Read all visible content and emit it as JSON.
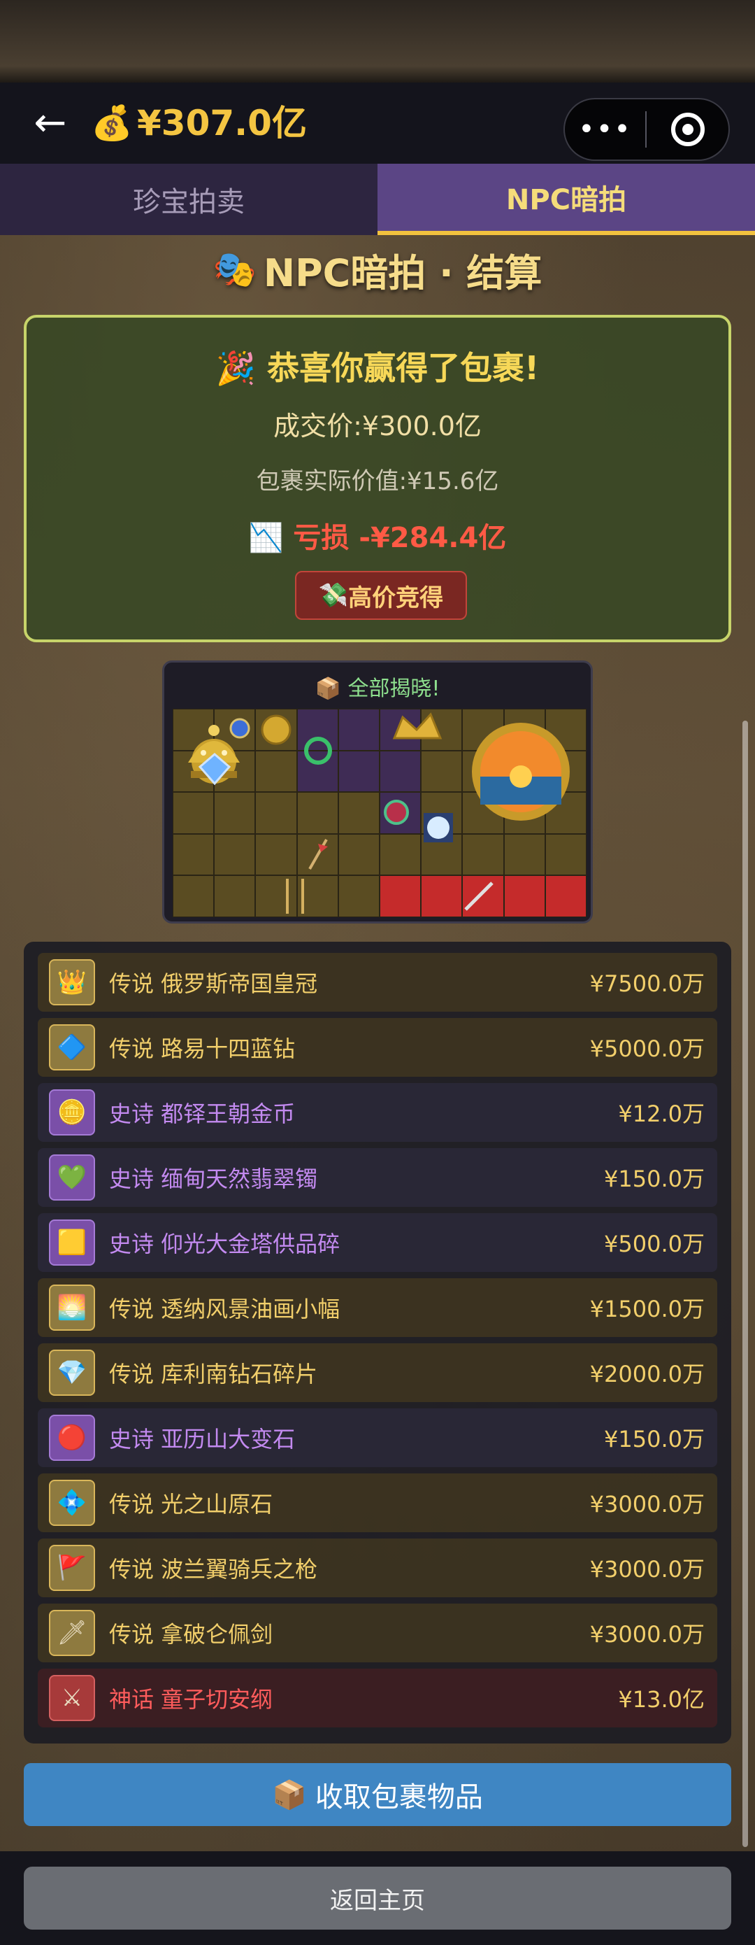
{
  "header": {
    "back_icon": "←",
    "money_icon": "💰",
    "balance": "¥307.0亿",
    "more_label": "•••"
  },
  "tabs": [
    {
      "label": "珍宝拍卖",
      "active": false
    },
    {
      "label": "NPC暗拍",
      "active": true
    }
  ],
  "page_title": "NPC暗拍 · 结算",
  "title_icon": "🎭",
  "result": {
    "congrats_icon": "🎉",
    "congrats": "恭喜你赢得了包裹!",
    "deal_price": "成交价:¥300.0亿",
    "actual_value": "包裹实际价值:¥15.6亿",
    "loss_icon": "📉",
    "loss": "亏损 -¥284.4亿",
    "badge_icon": "💸",
    "badge": "高价竞得"
  },
  "grid": {
    "title_icon": "📦",
    "title": "全部揭晓!"
  },
  "items": [
    {
      "rarity": "legend",
      "name": "传说 俄罗斯帝国皇冠",
      "price": "¥7500.0万",
      "icon": "👑"
    },
    {
      "rarity": "legend",
      "name": "传说 路易十四蓝钻",
      "price": "¥5000.0万",
      "icon": "🔷"
    },
    {
      "rarity": "epic",
      "name": "史诗 都铎王朝金币",
      "price": "¥12.0万",
      "icon": "🪙"
    },
    {
      "rarity": "epic",
      "name": "史诗 缅甸天然翡翠镯",
      "price": "¥150.0万",
      "icon": "💚"
    },
    {
      "rarity": "epic",
      "name": "史诗 仰光大金塔供品碎",
      "price": "¥500.0万",
      "icon": "🟨"
    },
    {
      "rarity": "legend",
      "name": "传说 透纳风景油画小幅",
      "price": "¥1500.0万",
      "icon": "🌅"
    },
    {
      "rarity": "legend",
      "name": "传说 库利南钻石碎片",
      "price": "¥2000.0万",
      "icon": "💎"
    },
    {
      "rarity": "epic",
      "name": "史诗 亚历山大变石",
      "price": "¥150.0万",
      "icon": "🔴"
    },
    {
      "rarity": "legend",
      "name": "传说 光之山原石",
      "price": "¥3000.0万",
      "icon": "💠"
    },
    {
      "rarity": "legend",
      "name": "传说 波兰翼骑兵之枪",
      "price": "¥3000.0万",
      "icon": "🚩"
    },
    {
      "rarity": "legend",
      "name": "传说 拿破仑佩剑",
      "price": "¥3000.0万",
      "icon": "🗡"
    },
    {
      "rarity": "myth",
      "name": "神话 童子切安纲",
      "price": "¥13.0亿",
      "icon": "⚔"
    }
  ],
  "collect_button": {
    "icon": "📦",
    "label": "收取包裹物品"
  },
  "home_button": "返回主页"
}
